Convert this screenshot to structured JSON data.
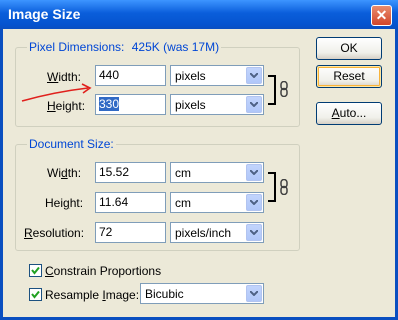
{
  "window": {
    "title": "Image Size",
    "close_glyph": "✕"
  },
  "pixel_dimensions": {
    "legend": "Pixel Dimensions:",
    "size_info": "425K (was 17M)",
    "width_label_prefix": "",
    "width_label_u": "W",
    "width_label_rest": "idth:",
    "height_label_u": "H",
    "height_label_rest": "eight:",
    "width_value": "440",
    "height_value": "330",
    "width_unit": "pixels",
    "height_unit": "pixels"
  },
  "document_size": {
    "legend": "Document Size:",
    "width_label_pre": "Wi",
    "width_label_u": "d",
    "width_label_rest": "th:",
    "height_label_pre": "Hei",
    "height_label_u": "g",
    "height_label_rest": "ht:",
    "resolution_label_u": "R",
    "resolution_label_rest": "esolution:",
    "width_value": "15.52",
    "height_value": "11.64",
    "resolution_value": "72",
    "width_unit": "cm",
    "height_unit": "cm",
    "resolution_unit": "pixels/inch"
  },
  "options": {
    "constrain_u": "C",
    "constrain_rest": "onstrain Proportions",
    "constrain_checked": true,
    "resample_pre": "Resample ",
    "resample_u": "I",
    "resample_rest": "mage:",
    "resample_checked": true,
    "resample_method": "Bicubic"
  },
  "buttons": {
    "ok": "OK",
    "reset": "Reset",
    "auto_u": "A",
    "auto_rest": "uto..."
  },
  "colors": {
    "legend_blue": "#0046D5",
    "titlebar_blue": "#0A5EDB",
    "annotation_red": "#E0201C",
    "dialog_bg": "#ECE9D8"
  },
  "icons": [
    "close-icon",
    "dropdown-arrow-icon",
    "chain-link-icon",
    "checkmark-icon"
  ]
}
